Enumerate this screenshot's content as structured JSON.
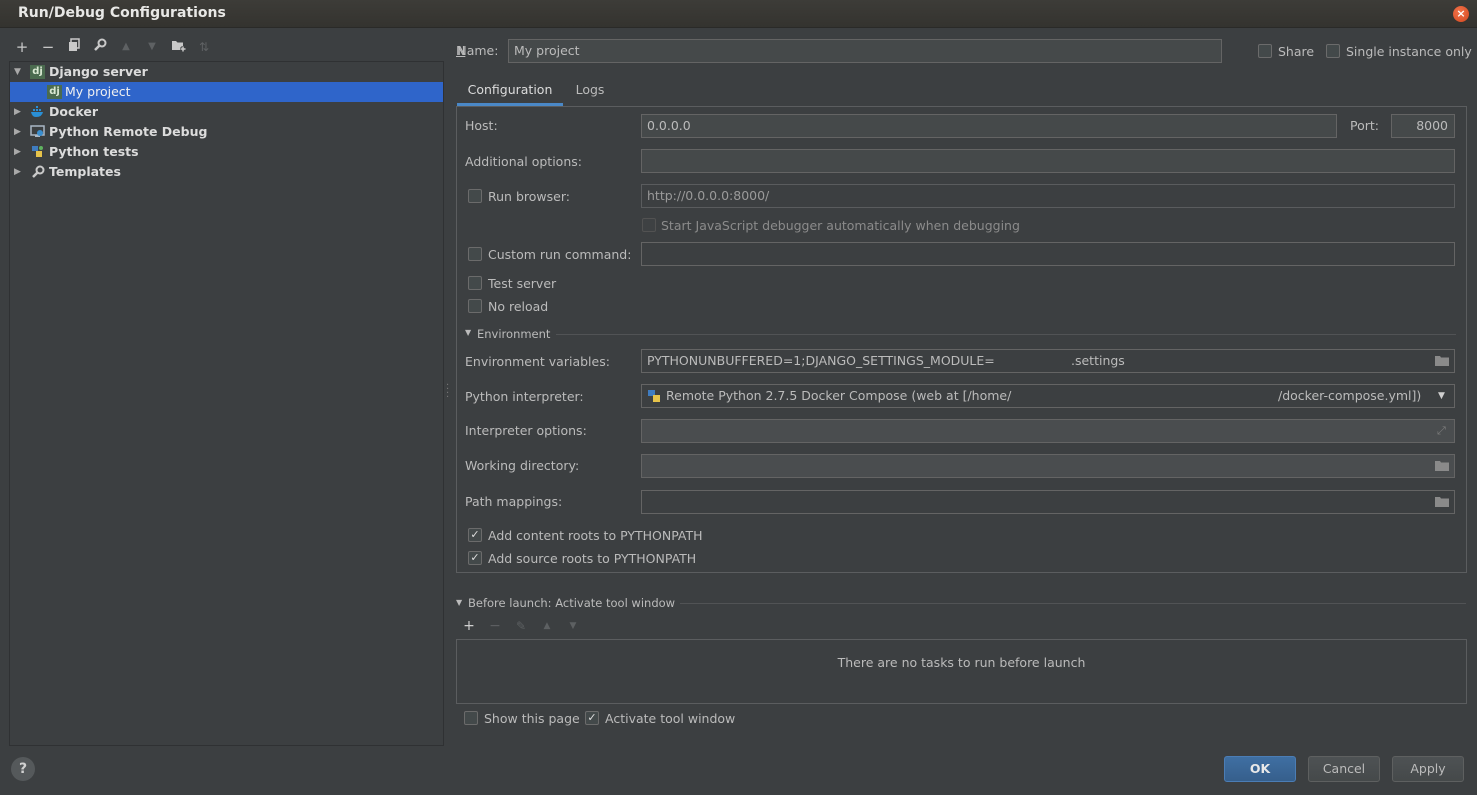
{
  "window": {
    "title": "Run/Debug Configurations"
  },
  "toolbar": {
    "add": "+",
    "remove": "−"
  },
  "tree": {
    "items": [
      {
        "label": "Django server",
        "icon": "dj"
      },
      {
        "label": "My project",
        "icon": "dj"
      },
      {
        "label": "Docker"
      },
      {
        "label": "Python Remote Debug"
      },
      {
        "label": "Python tests"
      },
      {
        "label": "Templates"
      }
    ]
  },
  "name_row": {
    "label": "Name:",
    "value": "My project",
    "share_label": "Share",
    "single_instance_label": "Single instance only"
  },
  "tabs": [
    {
      "label": "Configuration"
    },
    {
      "label": "Logs"
    }
  ],
  "config": {
    "host_label": "Host:",
    "host_value": "0.0.0.0",
    "port_label": "Port:",
    "port_value": "8000",
    "additional_options_label": "Additional options:",
    "additional_options_value": "",
    "run_browser_label": "Run browser:",
    "run_browser_url": "http://0.0.0.0:8000/",
    "js_debugger_label": "Start JavaScript debugger automatically when debugging",
    "custom_run_label": "Custom run command:",
    "custom_run_value": "",
    "test_server_label": "Test server",
    "no_reload_label": "No reload",
    "environment_section": "Environment",
    "env_vars_label": "Environment variables:",
    "env_vars_value": "PYTHONUNBUFFERED=1;DJANGO_SETTINGS_MODULE=",
    "env_vars_suffix": ".settings",
    "interpreter_label": "Python interpreter:",
    "interpreter_value": "Remote Python 2.7.5 Docker Compose (web at [/home/",
    "interpreter_suffix": "/docker-compose.yml])",
    "interpreter_options_label": "Interpreter options:",
    "working_dir_label": "Working directory:",
    "path_mappings_label": "Path mappings:",
    "content_roots_label": "Add content roots to PYTHONPATH",
    "source_roots_label": "Add source roots to PYTHONPATH"
  },
  "before_launch": {
    "title": "Before launch: Activate tool window",
    "empty_text": "There are no tasks to run before launch",
    "show_page_label": "Show this page",
    "activate_label": "Activate tool window"
  },
  "buttons": {
    "help": "?",
    "ok": "OK",
    "cancel": "Cancel",
    "apply": "Apply"
  },
  "colors": {
    "background": "#3c3f41",
    "selection": "#2f65ca",
    "accent": "#4a88c7"
  }
}
